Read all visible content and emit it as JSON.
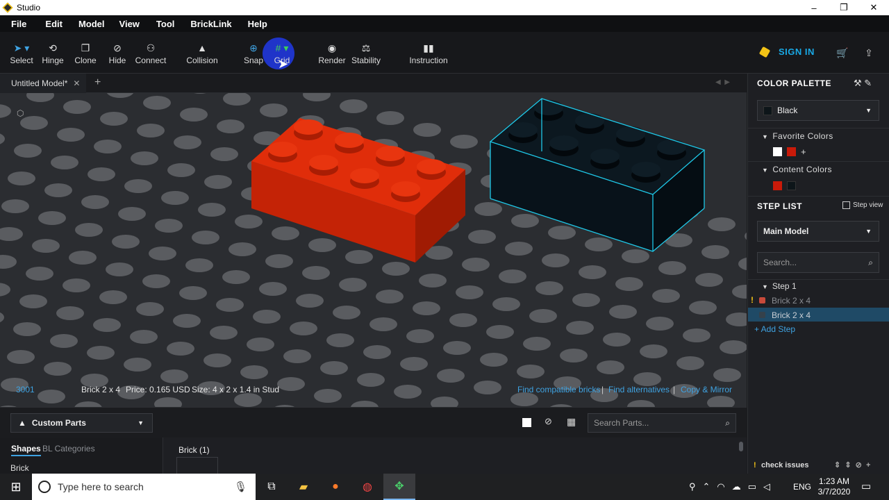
{
  "window": {
    "title": "Studio",
    "controls": [
      "–",
      "❐",
      "✕"
    ]
  },
  "menu": [
    "File",
    "Edit",
    "Model",
    "View",
    "Tool",
    "BrickLink",
    "Help"
  ],
  "toolbar": {
    "tools": [
      {
        "label": "Select",
        "icon": "select-icon",
        "glyph": "➤"
      },
      {
        "label": "Hinge",
        "icon": "hinge-icon",
        "glyph": "⟲"
      },
      {
        "label": "Clone",
        "icon": "clone-icon",
        "glyph": "❐"
      },
      {
        "label": "Hide",
        "icon": "hide-icon",
        "glyph": "⊘"
      },
      {
        "label": "Connect",
        "icon": "connect-icon",
        "glyph": "⚇"
      },
      {
        "label": "Collision",
        "icon": "collision-icon",
        "glyph": "▲"
      },
      {
        "label": "Snap",
        "icon": "snap-icon",
        "glyph": "⊕"
      },
      {
        "label": "Grid",
        "icon": "grid-icon",
        "glyph": "#"
      },
      {
        "label": "Render",
        "icon": "render-icon",
        "glyph": "◉"
      },
      {
        "label": "Stability",
        "icon": "stability-icon",
        "glyph": "⚖"
      },
      {
        "label": "Instruction",
        "icon": "instruction-icon",
        "glyph": "▮▮"
      }
    ],
    "signin": "SIGN IN"
  },
  "tab": {
    "name": "Untitled Model*"
  },
  "info": {
    "part_id": "3001",
    "name": "Brick 2 x 4",
    "price": "Price: 0.165 USD",
    "size": "Size: 4 x 2 x 1.4 in Stud",
    "links": [
      "Find compatible bricks",
      "Find alternatives",
      "Copy & Mirror"
    ]
  },
  "parts": {
    "dropdown": "Custom Parts",
    "search_placeholder": "Search Parts...",
    "tabs": [
      "Shapes",
      "BL Categories"
    ],
    "category": "Brick",
    "group": "Brick (1)"
  },
  "palette": {
    "title": "COLOR PALETTE",
    "selected": "Black",
    "favorites_title": "Favorite Colors",
    "content_title": "Content Colors",
    "favorite_colors": [
      "#ffffff",
      "#c91a09"
    ],
    "content_colors": [
      "#c91a09",
      "#0d1519"
    ]
  },
  "steps": {
    "title": "STEP LIST",
    "step_view": "Step view",
    "model": "Main Model",
    "search_placeholder": "Search...",
    "step": "Step 1",
    "items": [
      "Brick 2 x 4",
      "Brick 2 x 4"
    ],
    "add": "+ Add Step",
    "check": "check issues"
  },
  "taskbar": {
    "search": "Type here to search",
    "lang": "ENG",
    "time": "1:23 AM",
    "date": "3/7/2020"
  },
  "colors": {
    "red": "#d42a0a",
    "accent": "#3fa3e2",
    "black_brick": "#0d1a22",
    "outline": "#1ec8e8"
  }
}
